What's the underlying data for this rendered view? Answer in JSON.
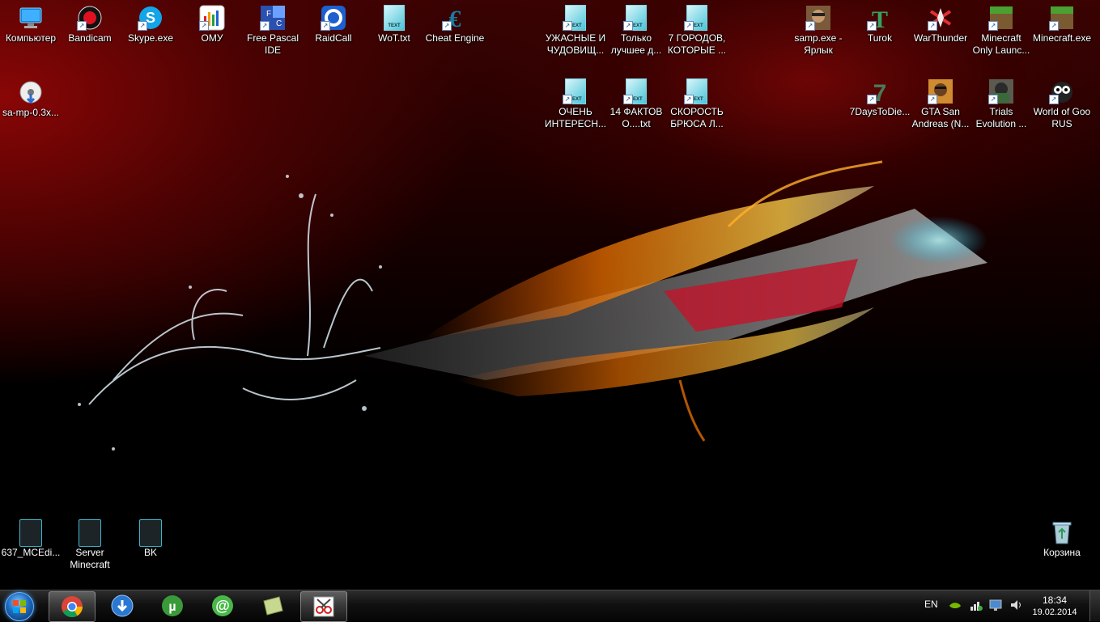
{
  "desktop": {
    "icons_left": [
      {
        "label": "Компьютер",
        "icon": "computer-icon"
      },
      {
        "label": "Bandicam",
        "icon": "bandicam-icon"
      },
      {
        "label": "Skype.exe",
        "icon": "skype-icon"
      },
      {
        "label": "ОМУ",
        "icon": "chart-app-icon"
      },
      {
        "label": "Free Pascal IDE",
        "icon": "free-pascal-icon"
      },
      {
        "label": "RaidCall",
        "icon": "raidcall-icon"
      },
      {
        "label": "WoT.txt",
        "icon": "text-file-icon"
      },
      {
        "label": "Cheat Engine",
        "icon": "cheat-engine-icon"
      },
      {
        "label": "sa-mp-0.3x...",
        "icon": "installer-icon"
      }
    ],
    "icons_middle": [
      {
        "label": "УЖАСНЫЕ И ЧУДОВИЩ...",
        "icon": "text-file-icon"
      },
      {
        "label": "Только лучшее д...",
        "icon": "text-file-icon"
      },
      {
        "label": "7 ГОРОДОВ, КОТОРЫЕ ...",
        "icon": "text-file-icon"
      },
      {
        "label": "ОЧЕНЬ ИНТЕРЕСН...",
        "icon": "text-file-icon"
      },
      {
        "label": "14 ФАКТОВ О....txt",
        "icon": "text-file-icon"
      },
      {
        "label": "СКОРОСТЬ БРЮСА Л...",
        "icon": "text-file-icon"
      }
    ],
    "icons_right": [
      {
        "label": "samp.exe - Ярлык",
        "icon": "samp-icon"
      },
      {
        "label": "Turok",
        "icon": "turok-icon"
      },
      {
        "label": "WarThunder",
        "icon": "warthunder-icon"
      },
      {
        "label": "Minecraft Only Launc...",
        "icon": "minecraft-icon"
      },
      {
        "label": "Minecraft.exe",
        "icon": "minecraft-icon"
      },
      {
        "label": "7DaysToDie...",
        "icon": "seven-days-icon"
      },
      {
        "label": "GTA San Andreas (N...",
        "icon": "gta-icon"
      },
      {
        "label": "Trials Evolution ...",
        "icon": "trials-icon"
      },
      {
        "label": "World of Goo RUS",
        "icon": "world-of-goo-icon"
      }
    ],
    "icons_bottom": [
      {
        "label": "637_MCEdi...",
        "icon": "folder-icon"
      },
      {
        "label": "Server Minecraft",
        "icon": "folder-icon"
      },
      {
        "label": "BK",
        "icon": "folder-icon"
      }
    ],
    "recycle_bin": {
      "label": "Корзина",
      "icon": "recycle-bin-icon"
    }
  },
  "taskbar": {
    "pinned": [
      {
        "name": "chrome",
        "icon": "chrome-icon",
        "active": true
      },
      {
        "name": "download-manager",
        "icon": "download-icon",
        "active": false
      },
      {
        "name": "utorrent",
        "icon": "utorrent-icon",
        "active": false
      },
      {
        "name": "mail-agent",
        "icon": "mail-agent-icon",
        "active": false
      },
      {
        "name": "notes",
        "icon": "notes-icon",
        "active": false
      },
      {
        "name": "snipping-tool",
        "icon": "scissors-icon",
        "active": true
      }
    ],
    "tray": {
      "language": "EN",
      "time": "18:34",
      "date": "19.02.2014"
    }
  },
  "colors": {
    "wallpaper_red": "#8a0606",
    "taskbar_bg": "#111111",
    "accent_blue": "#1e6bbf"
  }
}
